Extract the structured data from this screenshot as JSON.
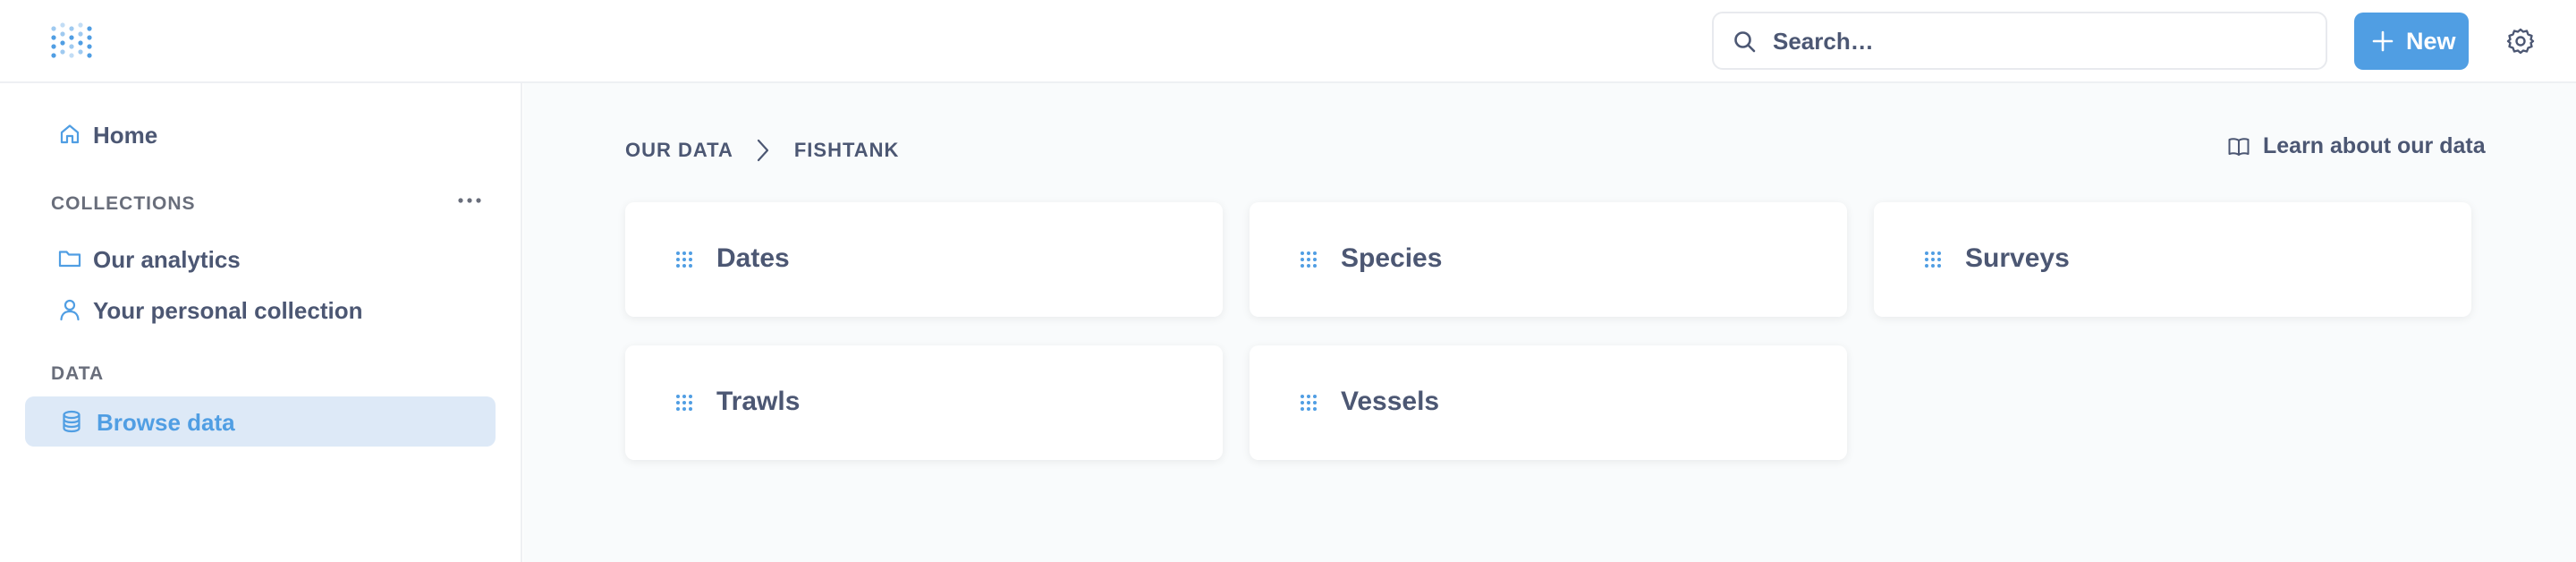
{
  "header": {
    "search_placeholder": "Search…",
    "new_label": "New",
    "accent": "#509ee3"
  },
  "sidebar": {
    "home": {
      "label": "Home",
      "icon": "home-icon"
    },
    "collections_title": "COLLECTIONS",
    "collections": [
      {
        "label": "Our analytics",
        "icon": "folder-icon"
      },
      {
        "label": "Your personal collection",
        "icon": "person-icon"
      }
    ],
    "data_title": "DATA",
    "browse": {
      "label": "Browse data",
      "icon": "database-icon",
      "active": true
    }
  },
  "main": {
    "breadcrumb": [
      "OUR DATA",
      "FISHTANK"
    ],
    "learn_label": "Learn about our data",
    "tables": [
      {
        "label": "Dates",
        "icon": "grid-icon"
      },
      {
        "label": "Species",
        "icon": "grid-icon"
      },
      {
        "label": "Surveys",
        "icon": "grid-icon"
      },
      {
        "label": "Trawls",
        "icon": "grid-icon"
      },
      {
        "label": "Vessels",
        "icon": "grid-icon"
      }
    ]
  }
}
